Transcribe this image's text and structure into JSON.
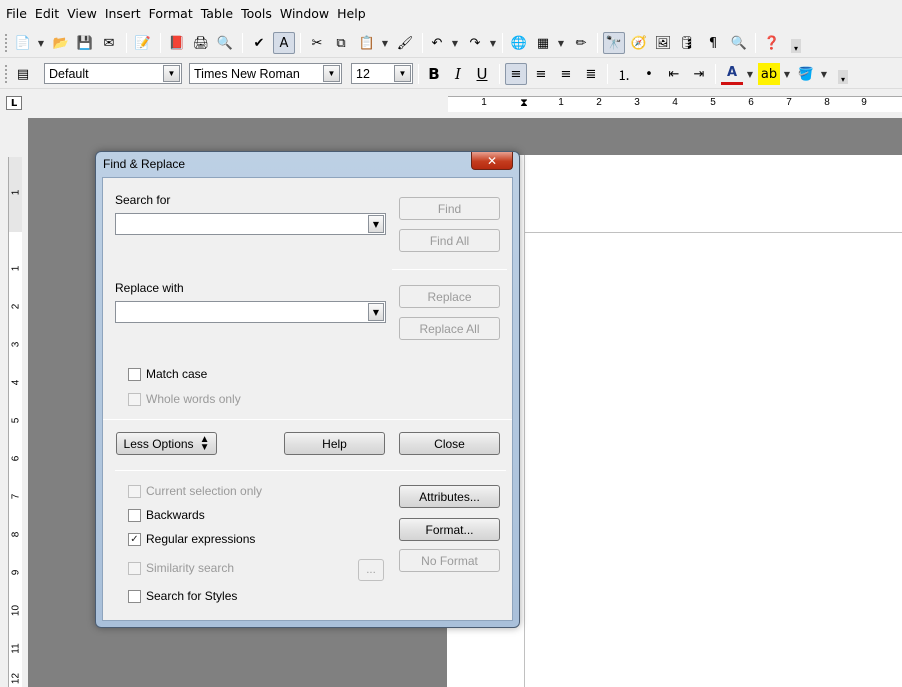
{
  "menubar": {
    "items": [
      "File",
      "Edit",
      "View",
      "Insert",
      "Format",
      "Table",
      "Tools",
      "Window",
      "Help"
    ]
  },
  "formatting_toolbar": {
    "paragraph_style": "Default",
    "font_name": "Times New Roman",
    "font_size": "12"
  },
  "rulers": {
    "horizontal_labels": [
      "1",
      "1",
      "2",
      "3",
      "4",
      "5",
      "6",
      "7",
      "8",
      "9"
    ],
    "vertical_labels": [
      "1",
      "1",
      "2",
      "3",
      "4",
      "5",
      "6",
      "7",
      "8",
      "9",
      "10",
      "11",
      "12"
    ]
  },
  "dialog": {
    "title": "Find & Replace",
    "close_glyph": "✕",
    "search_for_label": "Search for",
    "search_for_value": "",
    "replace_with_label": "Replace with",
    "replace_with_value": "",
    "find_button": "Find",
    "find_all_button": "Find All",
    "replace_button": "Replace",
    "replace_all_button": "Replace All",
    "match_case_label": "Match case",
    "whole_words_label": "Whole words only",
    "less_options_button": "Less Options",
    "help_button": "Help",
    "close_button": "Close",
    "current_selection_label": "Current selection only",
    "backwards_label": "Backwards",
    "regular_expressions_label": "Regular expressions",
    "similarity_search_label": "Similarity search",
    "ellipsis_button": "...",
    "search_styles_label": "Search for Styles",
    "attributes_button": "Attributes...",
    "format_button": "Format...",
    "no_format_button": "No Format",
    "checks": {
      "match_case": false,
      "whole_words": false,
      "current_selection": false,
      "backwards": false,
      "regular_expressions": true,
      "similarity_search": false,
      "search_styles": false
    }
  },
  "colors": {
    "dialog_frame": "#a9c0da",
    "close_button": "#c43c1e",
    "workspace": "#808080"
  }
}
